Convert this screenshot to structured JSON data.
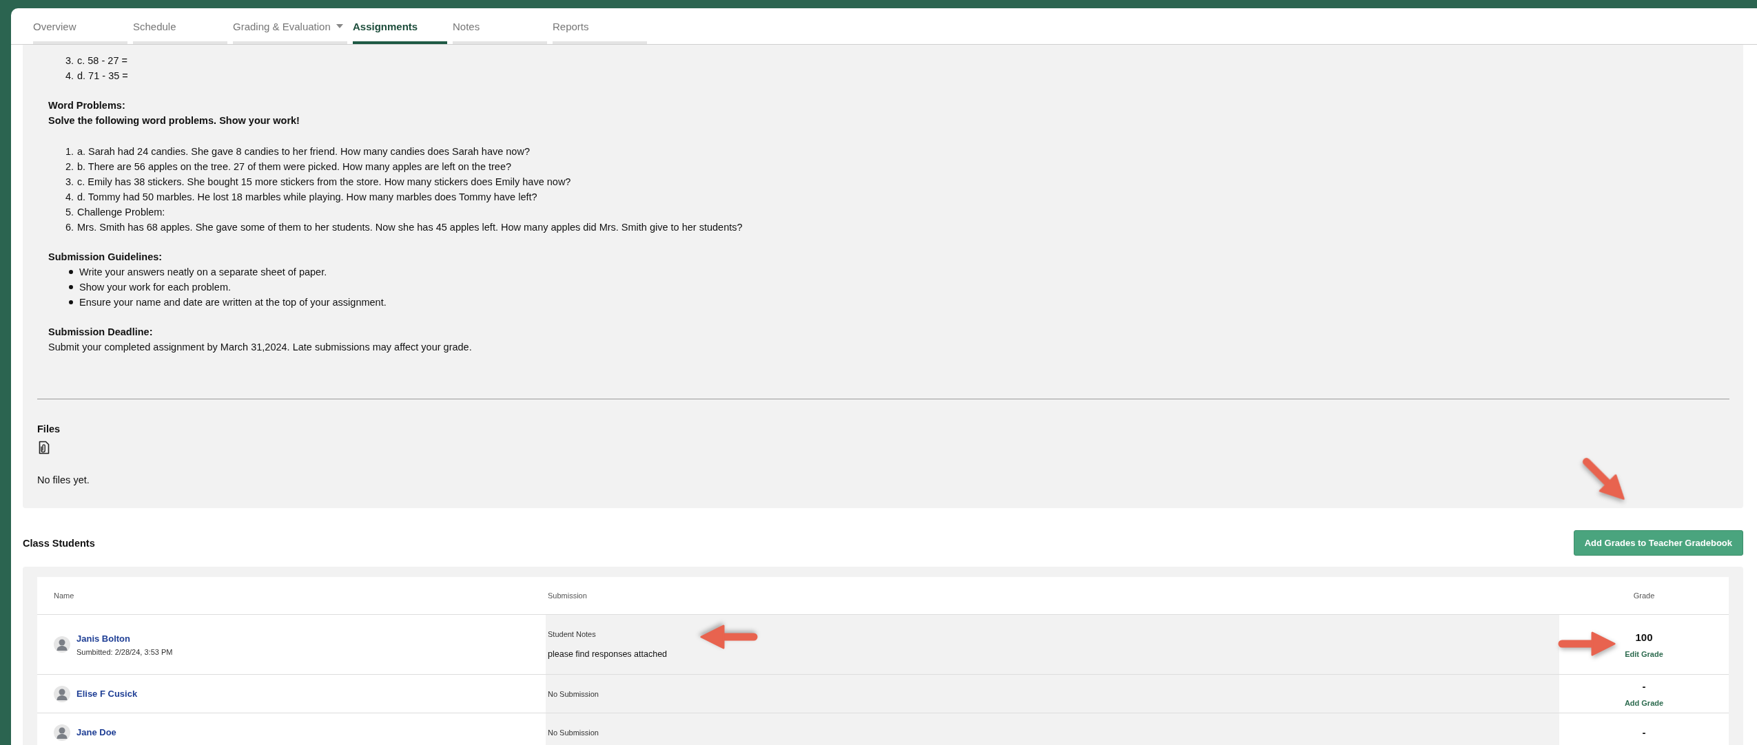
{
  "tabs": [
    {
      "label": "Overview",
      "selected": false,
      "dropdown": false
    },
    {
      "label": "Schedule",
      "selected": false,
      "dropdown": false
    },
    {
      "label": "Grading & Evaluation",
      "selected": false,
      "dropdown": true
    },
    {
      "label": "Assignments",
      "selected": true,
      "dropdown": false
    },
    {
      "label": "Notes",
      "selected": false,
      "dropdown": false
    },
    {
      "label": "Reports",
      "selected": false,
      "dropdown": false
    }
  ],
  "assignment": {
    "math_items": [
      {
        "number": "3.",
        "text": "c. 58 - 27 ="
      },
      {
        "number": "4.",
        "text": "d. 71 - 35 ="
      }
    ],
    "word_problems": {
      "heading": "Word Problems:",
      "instruction": "Solve the following word problems. Show your work!",
      "items": [
        {
          "number": "1.",
          "text": "a. Sarah had 24 candies. She gave 8 candies to her friend. How many candies does Sarah have now?"
        },
        {
          "number": "2.",
          "text": "b. There are 56 apples on the tree. 27 of them were picked. How many apples are left on the tree?"
        },
        {
          "number": "3.",
          "text": "c. Emily has 38 stickers. She bought 15 more stickers from the store. How many stickers does Emily have now?"
        },
        {
          "number": "4.",
          "text": "d. Tommy had 50 marbles. He lost 18 marbles while playing. How many marbles does Tommy have left?"
        },
        {
          "number": "5.",
          "text": "Challenge Problem:"
        },
        {
          "number": "6.",
          "text": "Mrs. Smith has 68 apples. She gave some of them to her students. Now she has 45 apples left. How many apples did Mrs. Smith give to her students?"
        }
      ]
    },
    "guidelines": {
      "heading": "Submission Guidelines:",
      "items": [
        "Write your answers neatly on a separate sheet of paper.",
        "Show your work for each problem.",
        "Ensure your name and date are written at the top of your assignment."
      ]
    },
    "deadline": {
      "heading": "Submission Deadline:",
      "text": "Submit your completed assignment by March 31,2024. Late submissions may affect your grade."
    }
  },
  "files": {
    "heading": "Files",
    "empty_text": "No files yet.",
    "annotation": {
      "kind": "diagonal_arrow"
    }
  },
  "students": {
    "heading": "Class Students",
    "button": "Add Grades to Teacher Gradebook",
    "columns": [
      "Name",
      "Submission",
      "Grade"
    ],
    "rows": [
      {
        "name": "Janis Bolton",
        "submitted": "Sumbitted: 2/28/24, 3:53 PM",
        "submission": {
          "kind": "notes",
          "label": "Student Notes",
          "text": "please find responses attached",
          "annotation": {
            "kind": "left_arrow"
          }
        },
        "grade": "100",
        "grade_action": "Edit Grade",
        "grade_annotation": {
          "kind": "right_arrow"
        }
      },
      {
        "name": "Elise F Cusick",
        "submission": {
          "kind": "none",
          "text": "No Submission"
        },
        "grade": "-",
        "grade_action": "Add Grade"
      },
      {
        "name": "Jane Doe",
        "submission": {
          "kind": "none",
          "text": "No Submission"
        },
        "grade": "-"
      }
    ]
  }
}
